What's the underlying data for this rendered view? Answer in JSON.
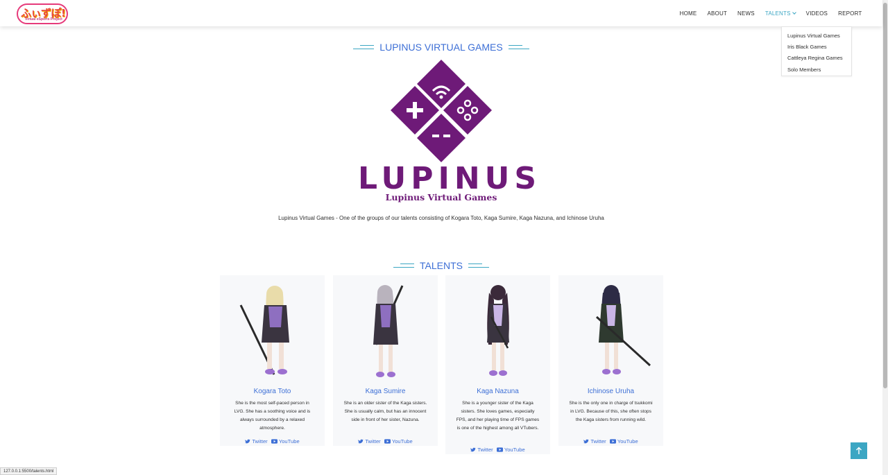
{
  "logo": {
    "main": "ふぃずぽ!",
    "sub": "Virtual eSports Project"
  },
  "nav": {
    "items": [
      {
        "label": "HOME"
      },
      {
        "label": "ABOUT"
      },
      {
        "label": "NEWS"
      },
      {
        "label": "TALENTS",
        "active": true
      },
      {
        "label": "VIDEOS"
      },
      {
        "label": "REPORT"
      }
    ]
  },
  "dropdown": {
    "items": [
      "Lupinus Virtual Games",
      "Iris Black Games",
      "Cattleya Regina Games",
      "Solo Members"
    ]
  },
  "group": {
    "title": "LUPINUS VIRTUAL GAMES",
    "logo_word": "LUPINUS",
    "logo_sub": "Lupinus Virtual Games",
    "description": "Lupinus Virtual Games - One of the groups of our talents consisting of Kogara Toto, Kaga Sumire, Kaga Nazuna, and Ichinose Uruha"
  },
  "talents_title": "TALENTS",
  "talents": [
    {
      "name": "Kogara Toto",
      "desc": "She is the most self-paced person in LVG. She has a soothing voice and is always surrounded by a relaxed atmosphere.",
      "twitter": "Twitter",
      "youtube": "YouTube",
      "hair": "#e9dcaa"
    },
    {
      "name": "Kaga Sumire",
      "desc": "She is an older sister of the Kaga sisters. She is usually calm, but has an innocent side in front of her sister, Nazuna.",
      "twitter": "Twitter",
      "youtube": "YouTube",
      "hair": "#b9b3bd"
    },
    {
      "name": "Kaga Nazuna",
      "desc": "She is a younger sister of the Kaga sisters. She loves games, especially FPS, and her playing time of FPS games is one of the highest among all VTubers.",
      "twitter": "Twitter",
      "youtube": "YouTube",
      "hair": "#3b2a3a"
    },
    {
      "name": "Ichinose Uruha",
      "desc": "She is the only one in charge of tsukkomi in LVG. Because of this, she often stops the Kaga sisters from running wild.",
      "twitter": "Twitter",
      "youtube": "YouTube",
      "hair": "#2d2b45"
    }
  ],
  "status_url": "127.0.0.1:5500/talents.html",
  "colors": {
    "accent": "#3ba6c3",
    "title_blue": "#3d6fd6",
    "brand_purple": "#6e1a78"
  }
}
